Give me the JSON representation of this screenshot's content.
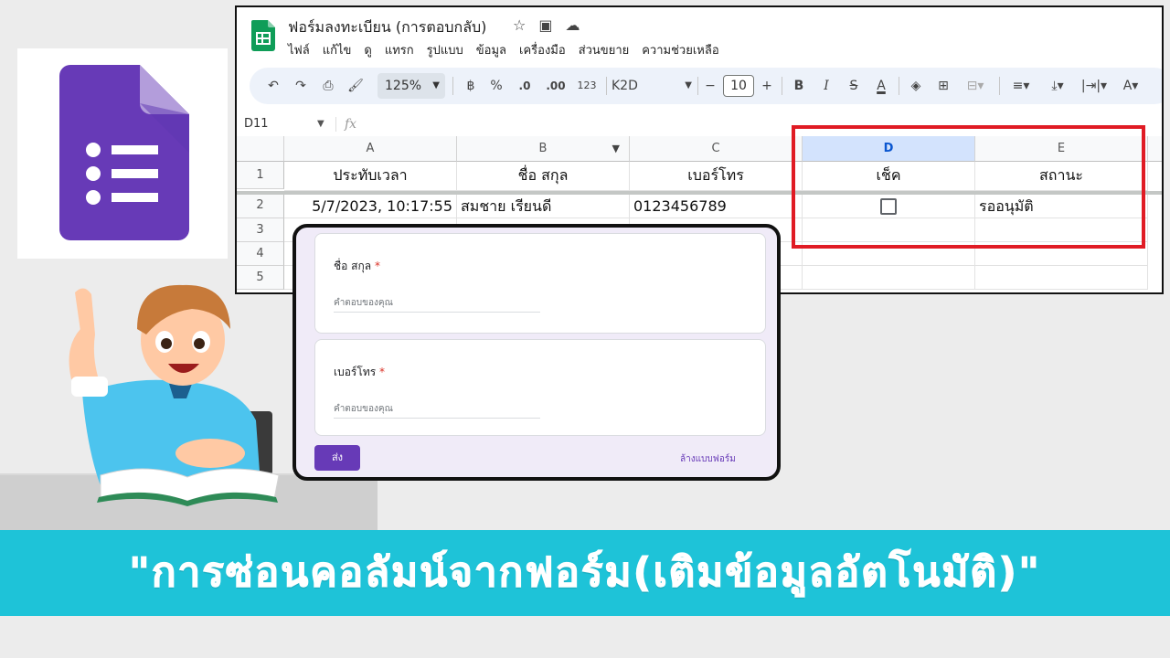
{
  "sheets": {
    "doc_title": "ฟอร์มลงทะเบียน (การตอบกลับ)",
    "title_icons": [
      "star-icon",
      "folder-move-icon",
      "cloud-status-icon"
    ],
    "menu": [
      "ไฟล์",
      "แก้ไข",
      "ดู",
      "แทรก",
      "รูปแบบ",
      "ข้อมูล",
      "เครื่องมือ",
      "ส่วนขยาย",
      "ความช่วยเหลือ"
    ],
    "toolbar": {
      "zoom": "125%",
      "currency": "฿",
      "percent": "%",
      "decrease_decimal": ".0",
      "increase_decimal": ".00",
      "number_format": "123",
      "font_name": "K2D",
      "font_size": "10",
      "bold": "B",
      "italic": "I",
      "strikethrough": "S",
      "text_color": "A"
    },
    "name_box": "D11",
    "fx_label": "fx",
    "columns": [
      "A",
      "B",
      "C",
      "D",
      "E"
    ],
    "rows": [
      "1",
      "2",
      "3",
      "4",
      "5"
    ],
    "header_row": [
      "ประทับเวลา",
      "ชื่อ สกุล",
      "เบอร์โทร",
      "เช็ค",
      "สถานะ"
    ],
    "data_row": {
      "timestamp": "5/7/2023, 10:17:55",
      "name": "สมชาย เรียนดี",
      "phone": "0123456789",
      "check": false,
      "status": "รออนุมัติ"
    },
    "selected_column": "D",
    "highlight_color": "#e01b24"
  },
  "form": {
    "questions": [
      {
        "label": "ชื่อ สกุล",
        "required_mark": "*",
        "placeholder": "คำตอบของคุณ"
      },
      {
        "label": "เบอร์โทร",
        "required_mark": "*",
        "placeholder": "คำตอบของคุณ"
      }
    ],
    "submit_label": "ส่ง",
    "clear_label": "ล้างแบบฟอร์ม",
    "accent_color": "#673ab7"
  },
  "banner": {
    "text": "\"การซ่อนคอลัมน์จากฟอร์ม(เติมข้อมูลอัตโนมัติ)\"",
    "color": "#1ec3d8"
  },
  "logo": {
    "name": "google-forms-logo",
    "color": "#673ab7"
  }
}
